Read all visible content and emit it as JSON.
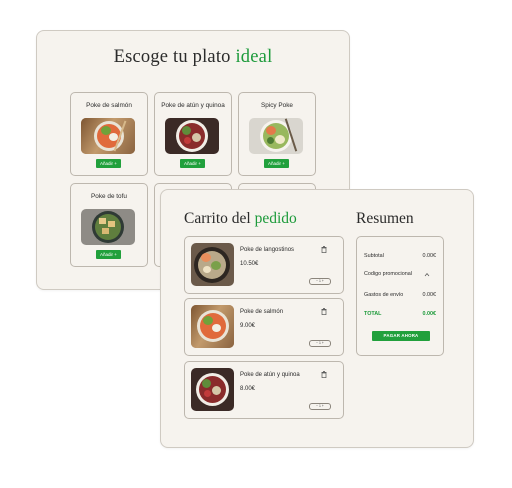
{
  "menu": {
    "title_prefix": "Escoge tu plato",
    "title_highlight": "ideal",
    "dishes": [
      {
        "name": "Poke de salmón",
        "button": "Añadir +"
      },
      {
        "name": "Poke de atún y quinoa",
        "button": "Añadir +"
      },
      {
        "name": "Spicy Poke",
        "button": "Añadir +"
      },
      {
        "name": "Poke de tofu",
        "button": "Añadir +"
      }
    ]
  },
  "cart": {
    "title_prefix": "Carrito del",
    "title_highlight": "pedido",
    "items": [
      {
        "name": "Poke de langostinos",
        "price": "10.50€",
        "qty": "1"
      },
      {
        "name": "Poke de salmón",
        "price": "9.00€",
        "qty": "1"
      },
      {
        "name": "Poke de atún y quinoa",
        "price": "8.00€",
        "qty": "1"
      }
    ],
    "stepper_minus": "−",
    "stepper_plus": "+"
  },
  "summary": {
    "title": "Resumen",
    "subtotal_label": "Subtotal",
    "subtotal_value": "0.00€",
    "promo_label": "Codigo promocional",
    "shipping_label": "Gastos de envío",
    "shipping_value": "0.00€",
    "total_label": "TOTAL",
    "total_value": "0.00€",
    "pay_button": "PAGAR AHORA"
  },
  "colors": {
    "accent": "#1c9a3a",
    "button": "#21a03c",
    "card_bg": "#f6f3ee",
    "border": "#bdb7ae"
  },
  "icons": {
    "trash": "trash-icon",
    "chevron": "chevron-up-icon"
  }
}
